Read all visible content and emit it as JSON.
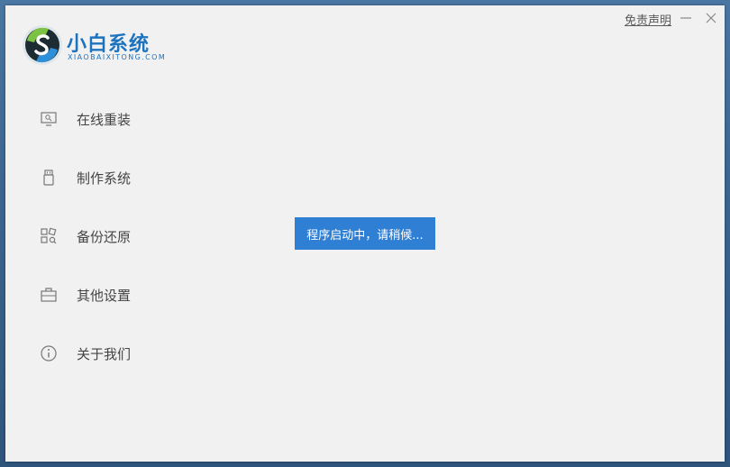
{
  "app": {
    "title": "小白系统",
    "subtitle": "XIAOBAIXITONG.COM",
    "brand_color": "#1e73be"
  },
  "header": {
    "disclaimer_label": "免责声明",
    "minimize_icon": "minimize-icon",
    "close_icon": "close-icon"
  },
  "sidebar": {
    "items": [
      {
        "label": "在线重装",
        "icon": "monitor-icon"
      },
      {
        "label": "制作系统",
        "icon": "usb-drive-icon"
      },
      {
        "label": "备份还原",
        "icon": "backup-grid-icon"
      },
      {
        "label": "其他设置",
        "icon": "toolbox-icon"
      },
      {
        "label": "关于我们",
        "icon": "info-icon"
      }
    ]
  },
  "status": {
    "message": "程序启动中，请稍候...",
    "color": "#2f7fd4"
  }
}
